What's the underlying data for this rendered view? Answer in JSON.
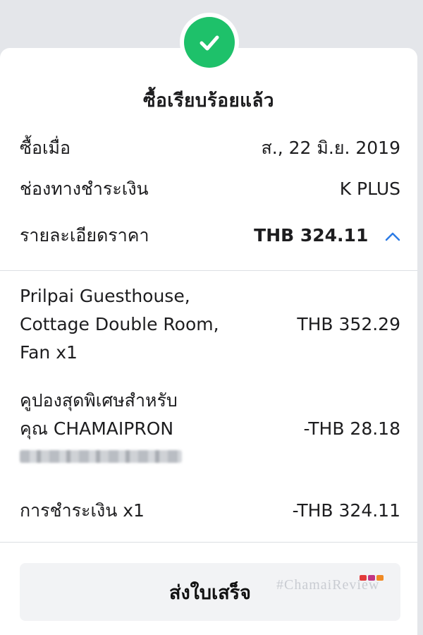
{
  "header": {
    "title": "ซื้อเรียบร้อยแล้ว",
    "status_icon": "check-circle-icon",
    "status_color": "#1ec16a"
  },
  "summary": {
    "purchase_date_label": "ซื้อเมื่อ",
    "purchase_date_value": "ส., 22 มิ.ย. 2019",
    "payment_channel_label": "ช่องทางชำระเงิน",
    "payment_channel_value": "K PLUS",
    "price_detail_label": "รายละเอียดราคา",
    "price_detail_value": "THB 324.11",
    "expand_icon": "chevron-up-icon",
    "accent_color": "#2c7be5"
  },
  "line_items": [
    {
      "label_lines": [
        "Prilpai Guesthouse,",
        "Cottage Double Room,",
        "Fan x1"
      ],
      "amount": "THB 352.29"
    },
    {
      "label_lines": [
        "คูปองสุดพิเศษสำหรับ",
        "คุณ CHAMAIPRON"
      ],
      "amount": "-THB 28.18"
    },
    {
      "label_lines": [
        "การชำระเงิน x1"
      ],
      "amount": "-THB 324.11"
    }
  ],
  "actions": {
    "send_receipt_label": "ส่งใบเสร็จ"
  },
  "watermark": {
    "text": "#ChamaiReview"
  }
}
